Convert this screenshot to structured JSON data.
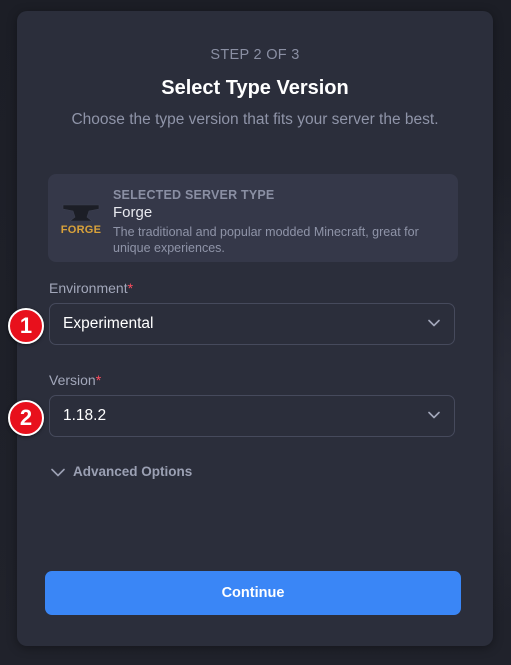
{
  "header": {
    "step": "STEP 2 OF 3",
    "title": "Select Type Version",
    "subtitle": "Choose the type version that fits your server the best."
  },
  "server_type": {
    "label": "SELECTED SERVER TYPE",
    "name": "Forge",
    "description": "The traditional and popular modded Minecraft, great for unique experiences.",
    "logo_icon": "forge-anvil-logo",
    "logo_text": "FORGE",
    "logo_color": "#d9a23a"
  },
  "environment": {
    "label": "Environment",
    "required_mark": "*",
    "value": "Experimental",
    "marker": "1"
  },
  "version": {
    "label": "Version",
    "required_mark": "*",
    "value": "1.18.2",
    "marker": "2"
  },
  "advanced": {
    "label": "Advanced Options",
    "icon": "chevron-down-icon"
  },
  "actions": {
    "continue_label": "Continue",
    "continue_color": "#3a86f6"
  },
  "colors": {
    "background": "#1d1f28",
    "card": "#2b2e3b",
    "required": "#ff4d5e",
    "marker": "#e8101c"
  }
}
